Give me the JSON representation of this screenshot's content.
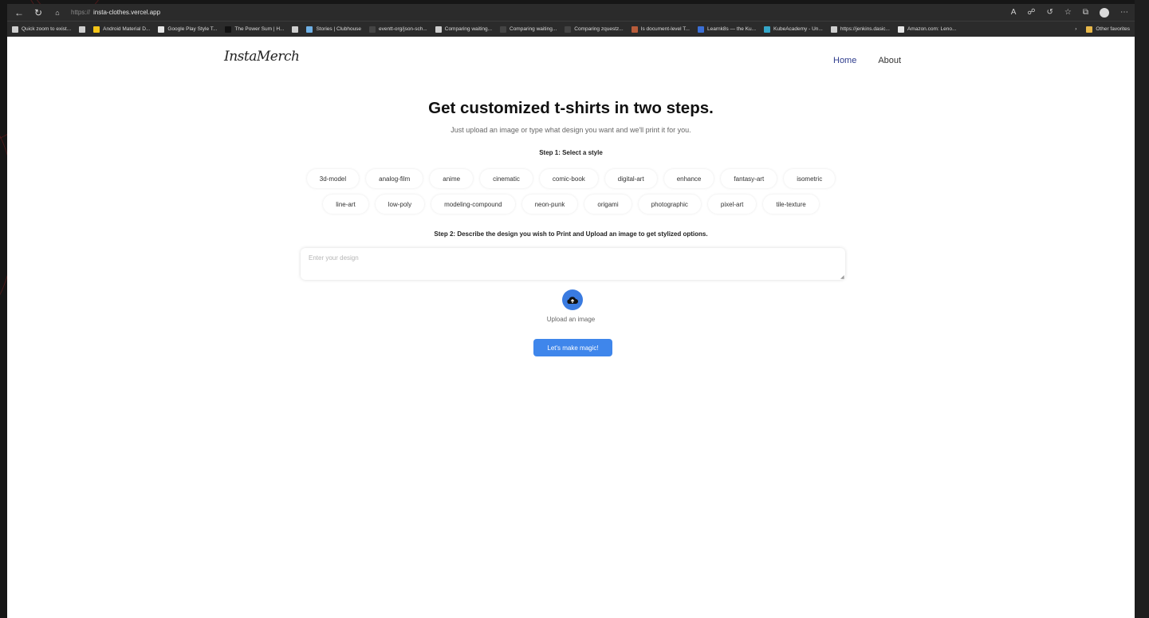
{
  "browser": {
    "url_protocol": "https://",
    "url_host": "insta-clothes.vercel.app",
    "bookmarks": [
      {
        "label": "Quick zoom to exist...",
        "color": "#cfcfcf"
      },
      {
        "label": "",
        "color": "#cfcfcf"
      },
      {
        "label": "Android Material D...",
        "color": "#f5c518"
      },
      {
        "label": "Google Play Style T...",
        "color": "#e6e6e6"
      },
      {
        "label": "The Power Sum | H...",
        "color": "#111111"
      },
      {
        "label": "",
        "color": "#cfcfcf"
      },
      {
        "label": "Stories | Clubhouse",
        "color": "#6fb1e6"
      },
      {
        "label": "eventt-org/json-sch...",
        "color": "#444444"
      },
      {
        "label": "Comparing waiting...",
        "color": "#cfcfcf"
      },
      {
        "label": "Comparing waiting...",
        "color": "#444444"
      },
      {
        "label": "Comparing zquestz...",
        "color": "#444444"
      },
      {
        "label": "Is document-level T...",
        "color": "#b85c3a"
      },
      {
        "label": "Learnk8s — the Ku...",
        "color": "#3b6fd6"
      },
      {
        "label": "KubeAcademy - Un...",
        "color": "#35a7c9"
      },
      {
        "label": "https://jenkins.dasic...",
        "color": "#cfcfcf"
      },
      {
        "label": "Amazon.com: Leno...",
        "color": "#e6e6e6"
      }
    ],
    "other_favorites": "Other favorites"
  },
  "header": {
    "logo": "InstaMerch",
    "nav": [
      {
        "label": "Home",
        "active": true
      },
      {
        "label": "About",
        "active": false
      }
    ]
  },
  "hero": {
    "title": "Get customized t-shirts in two steps.",
    "subtitle": "Just upload an image or type what design you want and we'll print it for you."
  },
  "step1": {
    "label": "Step 1: Select a style",
    "row1": [
      "3d-model",
      "analog-film",
      "anime",
      "cinematic",
      "comic-book",
      "digital-art",
      "enhance",
      "fantasy-art",
      "isometric"
    ],
    "row2": [
      "line-art",
      "low-poly",
      "modeling-compound",
      "neon-punk",
      "origami",
      "photographic",
      "pixel-art",
      "tile-texture"
    ]
  },
  "step2": {
    "label": "Step 2: Describe the design you wish to Print and Upload an image to get stylized options.",
    "placeholder": "Enter your design",
    "upload_label": "Upload an image",
    "submit_label": "Let's make magic!"
  },
  "colors": {
    "accent": "#3f86eb",
    "active_nav": "#2d3b8c"
  }
}
